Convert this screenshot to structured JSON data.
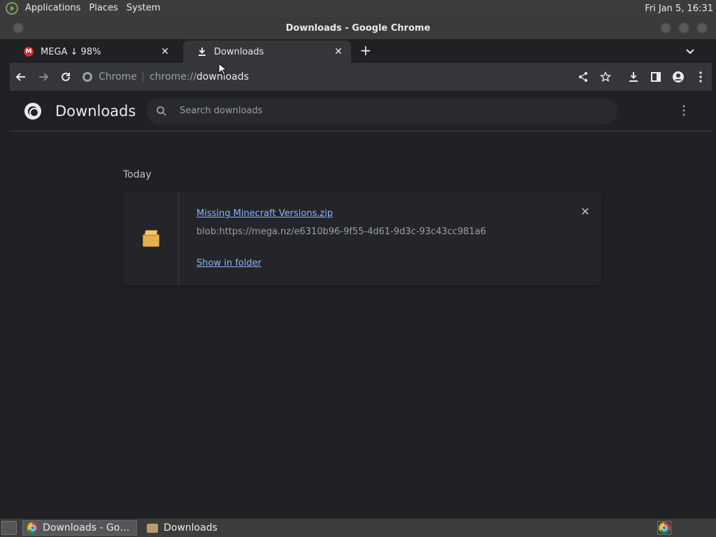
{
  "top_panel": {
    "menus": [
      "Applications",
      "Places",
      "System"
    ],
    "clock": "Fri Jan  5, 16:31"
  },
  "window": {
    "title": "Downloads - Google Chrome"
  },
  "tabs": [
    {
      "label": "MEGA ↓ 98%",
      "icon": "mega-icon",
      "favicon_text": "M"
    },
    {
      "label": "Downloads",
      "icon": "download-icon"
    }
  ],
  "omnibox": {
    "chip_label": "Chrome",
    "url_scheme": "chrome://",
    "url_host": "downloads"
  },
  "downloads_page": {
    "title": "Downloads",
    "search_placeholder": "Search downloads",
    "date_group": "Today",
    "items": [
      {
        "file_name": "Missing Minecraft Versions.zip",
        "url": "blob:https://mega.nz/e6310b96-9f55-4d61-9d3c-93c43cc981a6",
        "action_label": "Show in folder"
      }
    ]
  },
  "taskbar": {
    "tasks": [
      {
        "label": "Downloads - Googl...",
        "icon": "chrome-icon",
        "active": true
      },
      {
        "label": "Downloads",
        "icon": "folder-icon",
        "active": false
      }
    ]
  },
  "colors": {
    "page_bg": "#202124",
    "toolbar_bg": "#35363a",
    "link": "#8ab4f8",
    "mega_red": "#d9272e"
  }
}
